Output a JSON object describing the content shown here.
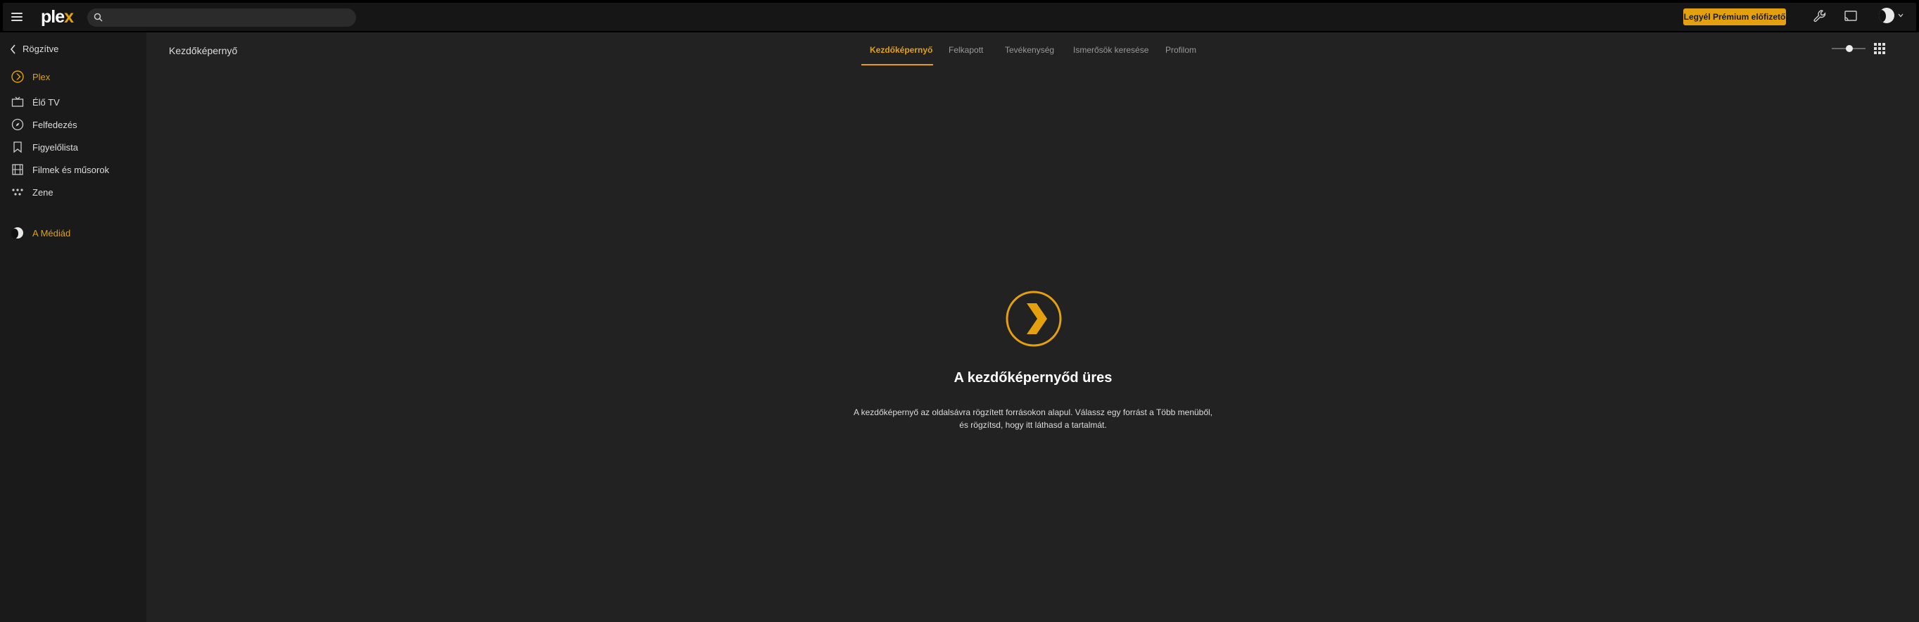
{
  "brand": {
    "logo_prefix": "ple",
    "logo_suffix": "x",
    "accent": "#e5a00d"
  },
  "search": {
    "placeholder": "",
    "value": ""
  },
  "topbar": {
    "premium_label": "Legyél Prémium előfizető"
  },
  "sidebar": {
    "pinned_label": "Rögzítve",
    "items": [
      {
        "label": "Plex",
        "icon": "plex-chevron-icon",
        "active": true
      },
      {
        "label": "Élő TV",
        "icon": "tv-icon"
      },
      {
        "label": "Felfedezés",
        "icon": "compass-icon"
      },
      {
        "label": "Figyelőlista",
        "icon": "bookmark-icon"
      },
      {
        "label": "Filmek és műsorok",
        "icon": "film-icon"
      },
      {
        "label": "Zene",
        "icon": "music-icon"
      }
    ],
    "media_label": "A Médiád"
  },
  "main": {
    "page_title": "Kezdőképernyő",
    "tabs": [
      {
        "label": "Kezdőképernyő",
        "active": true
      },
      {
        "label": "Felkapott"
      },
      {
        "label": "Tevékenység"
      },
      {
        "label": "Ismerősök keresése"
      },
      {
        "label": "Profilom"
      }
    ],
    "empty_title": "A kezdőképernyőd üres",
    "empty_line1": "A kezdőképernyő az oldalsávra rögzített forrásokon alapul. Válassz egy forrást a Több menüből,",
    "empty_line2": "és rögzítsd, hogy itt láthasd a tartalmát."
  }
}
